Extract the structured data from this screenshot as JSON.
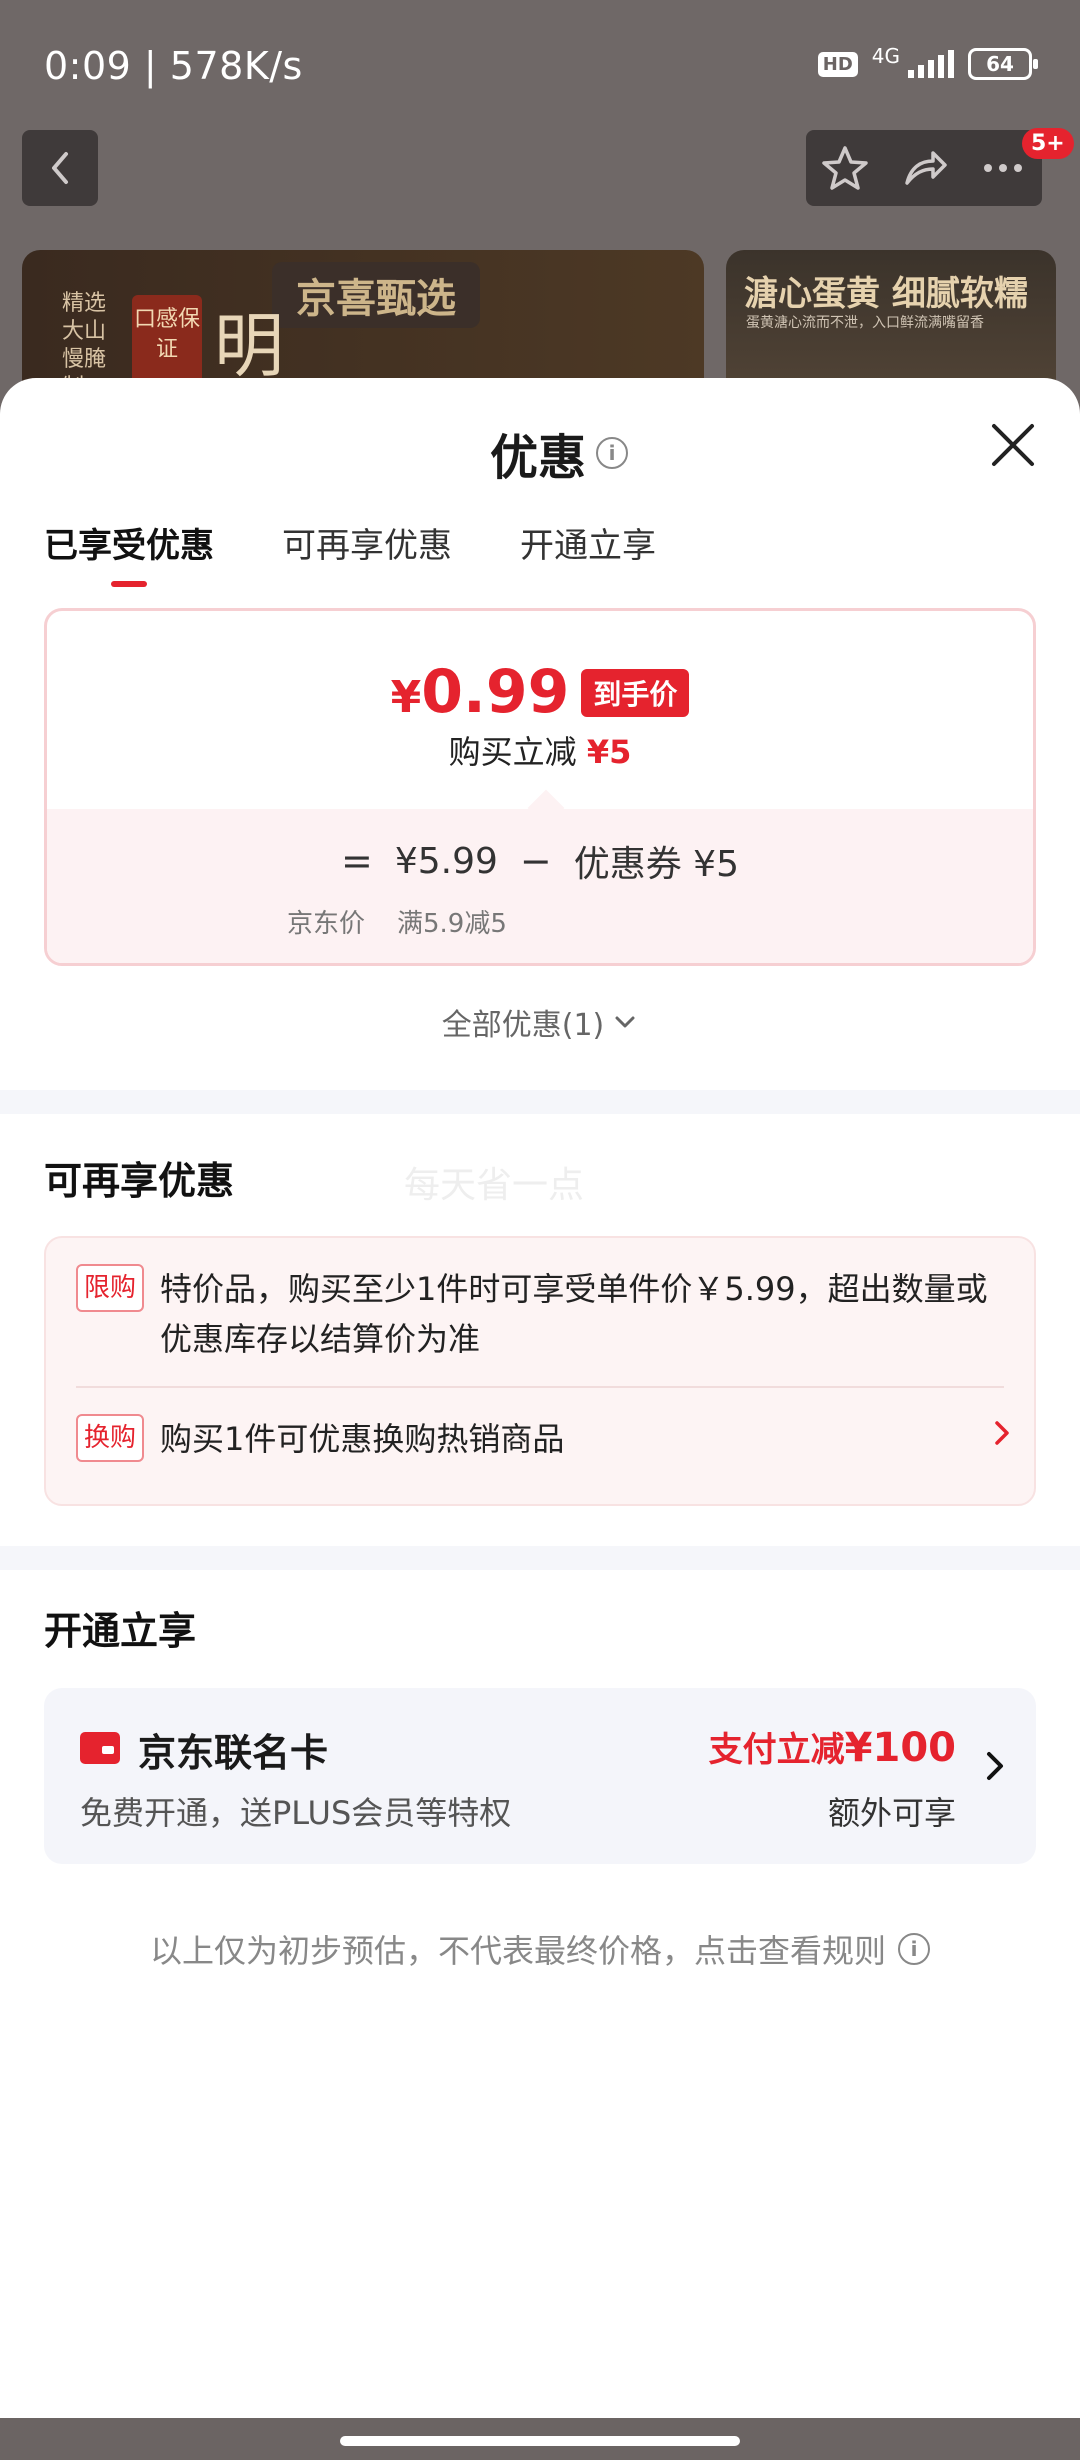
{
  "status_bar": {
    "time": "0:09 | 578K/s",
    "hd": "HD",
    "network": "4G",
    "battery": "64"
  },
  "nav": {
    "badge": "5+",
    "icons": [
      "back-icon",
      "star-icon",
      "share-icon",
      "more-icon"
    ]
  },
  "background": {
    "banner1_title": "京喜甄选",
    "banner1_stamp": "口感保证",
    "banner1_side": "精选大山慢腌制",
    "banner1_glyph": "明",
    "banner2_title": "溏心蛋黄 细腻软糯",
    "banner2_sub": "蛋黄溏心流而不泄，入口鲜流满嘴留香"
  },
  "sheet": {
    "title": "优惠",
    "tabs": [
      "已享受优惠",
      "可再享优惠",
      "开通立享"
    ],
    "active_tab": 0
  },
  "price_card": {
    "yen": "¥",
    "price": "0.99",
    "price_tag": "到手价",
    "sub_label": "购买立减",
    "sub_value": "¥5",
    "eq": "=",
    "jd_price": "¥5.99",
    "minus": "−",
    "coupon": "优惠券 ¥5",
    "jd_price_label": "京东价",
    "coupon_label": "满5.9减5"
  },
  "all_discounts": "全部优惠(1)",
  "more_section": {
    "title": "可再享优惠",
    "watermark": "每天省一点",
    "rows": [
      {
        "tag": "限购",
        "text": "特价品，购买至少1件时可享受单件价￥5.99，超出数量或优惠库存以结算价为准"
      },
      {
        "tag": "换购",
        "text": "购买1件可优惠换购热销商品"
      }
    ]
  },
  "open_section": {
    "title": "开通立享",
    "card_name": "京东联名卡",
    "card_desc": "免费开通，送PLUS会员等特权",
    "promo_prefix": "支付立减",
    "promo_amount": "¥100",
    "promo_extra": "额外可享"
  },
  "disclaimer": "以上仅为初步预估，不代表最终价格，点击查看规则",
  "colors": {
    "accent_red": "#e5232e",
    "card_bg": "#f4f5fa",
    "pink_bg": "#fdf2f3"
  }
}
